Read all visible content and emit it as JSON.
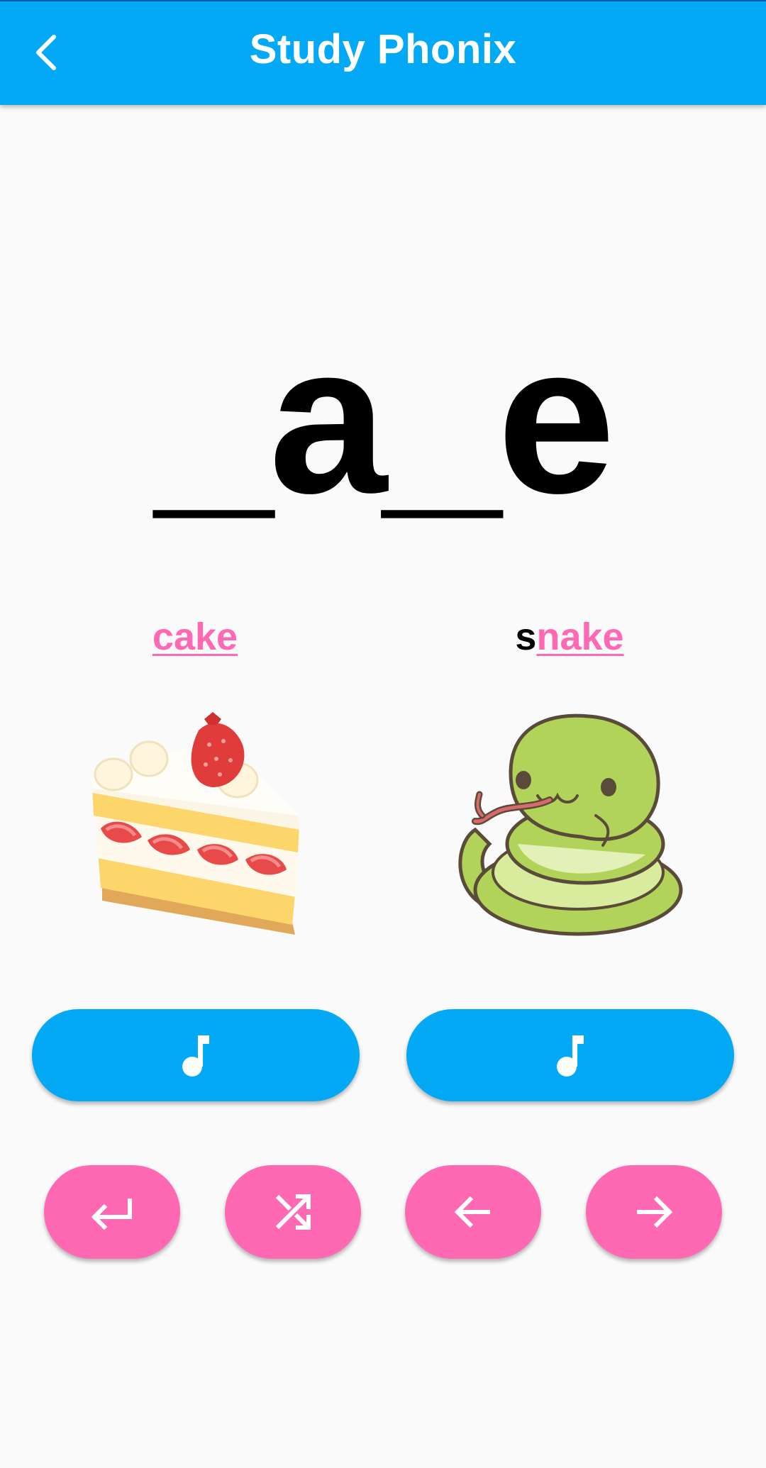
{
  "header": {
    "title": "Study Phonix",
    "back_icon": "chevron-left-icon",
    "color": "#03a9f4"
  },
  "phonics": {
    "pattern": "_a_e"
  },
  "words": [
    {
      "prefix": "",
      "highlight": "cake",
      "image": "strawberry-shortcake"
    },
    {
      "prefix": "s",
      "highlight": "nake",
      "image": "green-snake"
    }
  ],
  "buttons": {
    "play_icon": "music-note-icon",
    "nav": [
      "return-icon",
      "shuffle-icon",
      "arrow-left-icon",
      "arrow-right-icon"
    ],
    "play_color": "#03a9f4",
    "nav_color": "#ff69b4"
  },
  "colors": {
    "highlight": "#ff69b4",
    "background": "#fafafa"
  }
}
